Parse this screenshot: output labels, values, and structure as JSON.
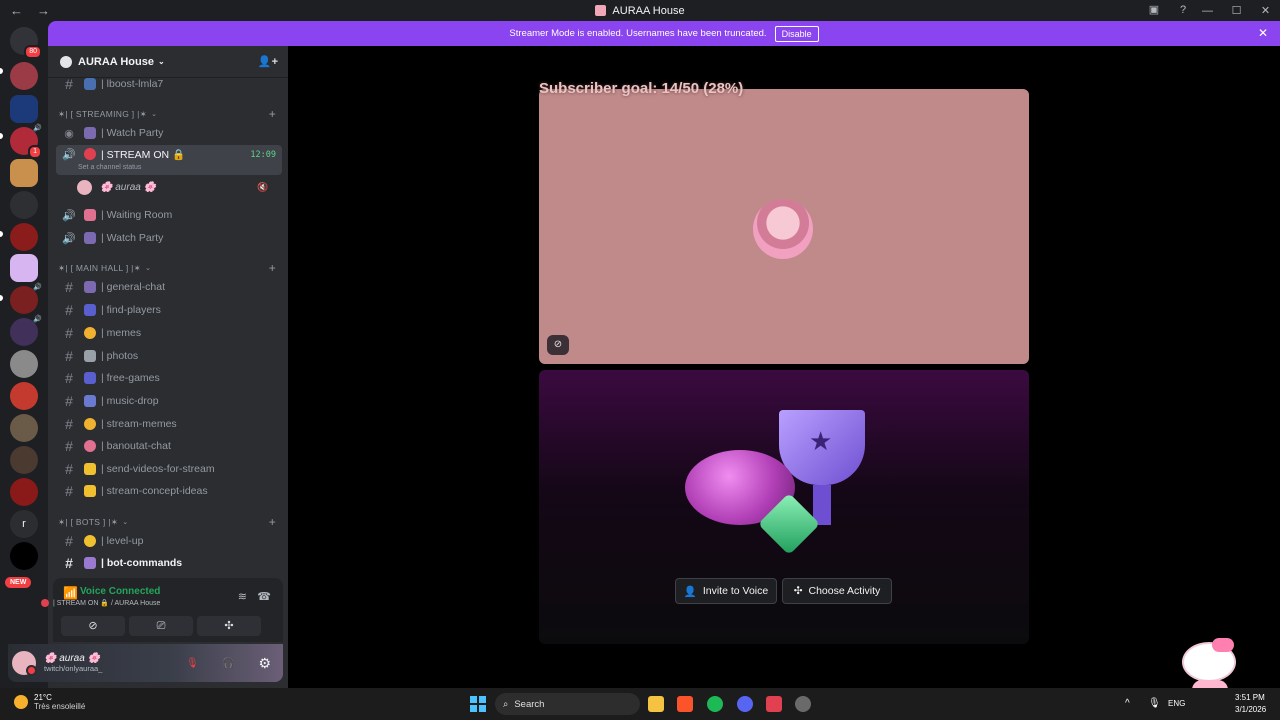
{
  "window": {
    "title": "AURAA House"
  },
  "banner": {
    "message": "Streamer Mode is enabled. Usernames have been truncated.",
    "button": "Disable"
  },
  "guilds": {
    "home_badge": "80",
    "mention_badge": "1",
    "new_label": "NEW",
    "letter": "r"
  },
  "server": {
    "name": "AURAA House"
  },
  "channels": {
    "boost": "| lboost-lmla7",
    "cat_streaming": "✶| [ STREAMING ] |✶",
    "watch_party_1": "| Watch Party",
    "stream_on": "| STREAM ON 🔒",
    "stream_time": "12:09",
    "stream_status": "Set a channel status",
    "voice_user": "auraa",
    "waiting_room": "| Waiting Room",
    "watch_party_2": "| Watch Party",
    "cat_main": "✶| [ MAIN HALL ] |✶",
    "general": "| general-chat",
    "find_players": "| find-players",
    "memes": "| memes",
    "photos": "| photos",
    "free_games": "| free-games",
    "music_drop": "| music-drop",
    "stream_memes": "| stream-memes",
    "banoutat": "| banoutat-chat",
    "send_videos": "| send-videos-for-stream",
    "concept": "| stream-concept-ideas",
    "cat_bots": "✶| [ BOTS ] |✶",
    "level_up": "| level-up",
    "bot_commands": "| bot-commands"
  },
  "voice_panel": {
    "status": "Voice Connected",
    "channel": "| STREAM ON 🔒 / AURAA House"
  },
  "user_panel": {
    "name": "🌸 auraa 🌸",
    "status": "twitch/onlyauraa_"
  },
  "stage": {
    "goal": "Subscriber goal: 14/50 (28%)",
    "invite": "Invite to Voice",
    "activity": "Choose Activity"
  },
  "taskbar": {
    "temp": "21°C",
    "weather": "Très ensoleillé",
    "search": "Search",
    "lang": "ENG",
    "time": "3:51 PM",
    "date": "3/1/2026"
  },
  "colors": {
    "accent": "#8a44f0",
    "online": "#23a55a",
    "danger": "#f23f43",
    "stream_bg": "#c08a8a"
  }
}
